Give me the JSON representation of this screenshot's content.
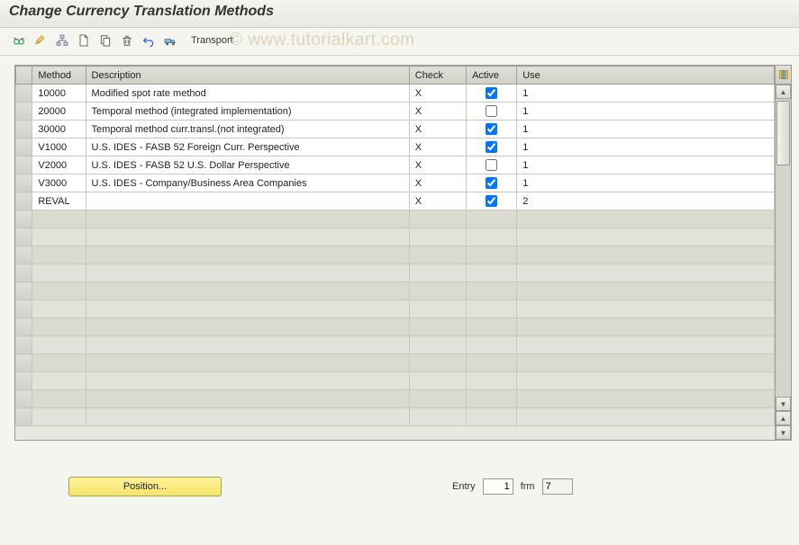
{
  "title": "Change Currency Translation Methods",
  "toolbar": {
    "transport_label": "Transport"
  },
  "watermark": "© www.tutorialkart.com",
  "columns": {
    "method": "Method",
    "description": "Description",
    "check": "Check",
    "active": "Active",
    "use": "Use"
  },
  "rows": [
    {
      "method": "10000",
      "description": "Modified spot rate method",
      "check": "X",
      "active": true,
      "use": "1"
    },
    {
      "method": "20000",
      "description": "Temporal method (integrated implementation)",
      "check": "X",
      "active": false,
      "use": "1"
    },
    {
      "method": "30000",
      "description": "Temporal method curr.transl.(not integrated)",
      "check": "X",
      "active": true,
      "use": "1"
    },
    {
      "method": "V1000",
      "description": "U.S. IDES - FASB 52 Foreign Curr. Perspective",
      "check": "X",
      "active": true,
      "use": "1"
    },
    {
      "method": "V2000",
      "description": "U.S. IDES - FASB 52 U.S. Dollar   Perspective",
      "check": "X",
      "active": false,
      "use": "1"
    },
    {
      "method": "V3000",
      "description": "U.S. IDES - Company/Business Area Companies",
      "check": "X",
      "active": true,
      "use": "1"
    },
    {
      "method": "REVAL",
      "description": "",
      "check": "X",
      "active": true,
      "use": "2"
    }
  ],
  "position_button": "Position...",
  "entry": {
    "label": "Entry",
    "current": "1",
    "frm_label": "frm",
    "total": "7"
  }
}
